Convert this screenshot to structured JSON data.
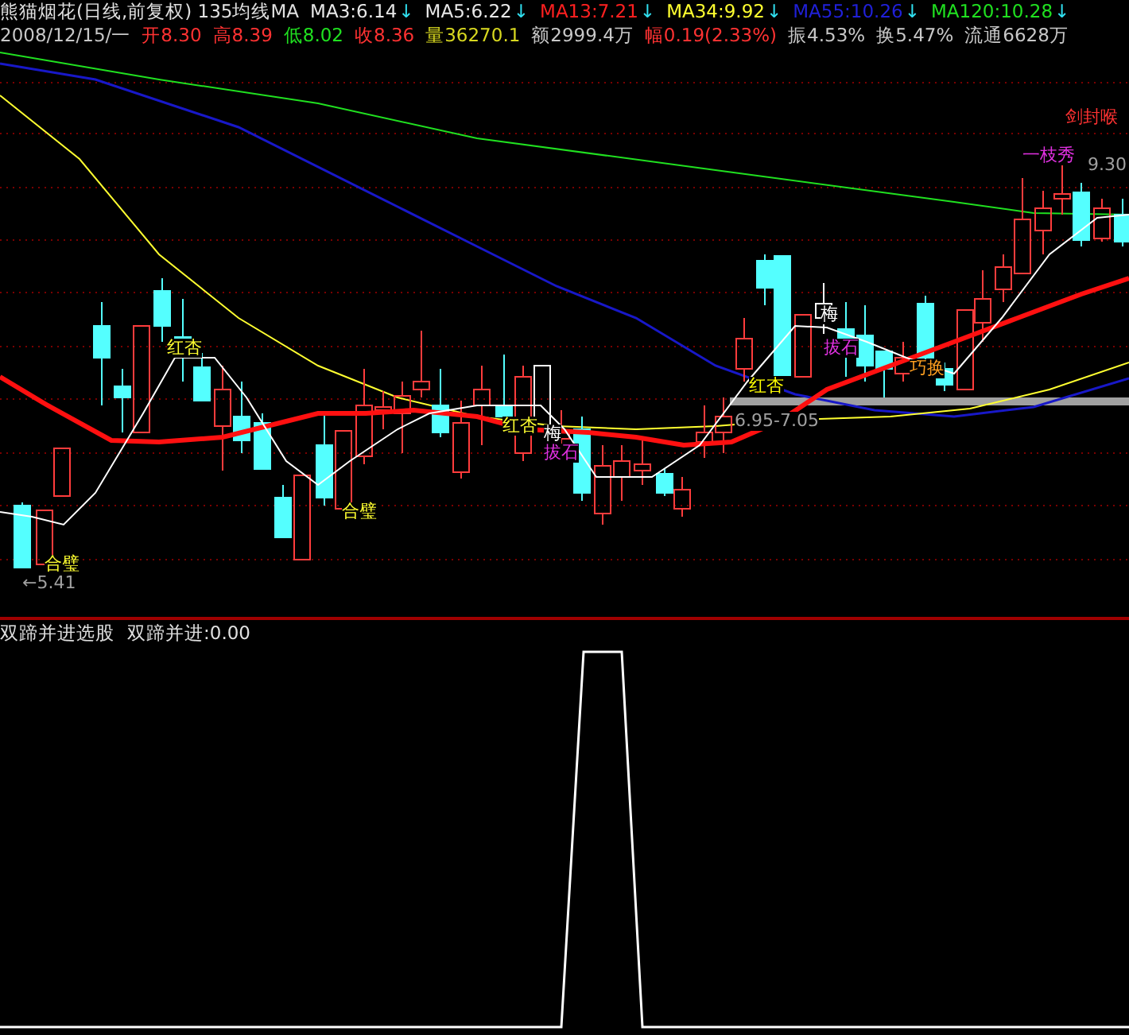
{
  "chart_title": {
    "name": "熊猫烟花(日线,前复权)",
    "indicator": "135均线MA"
  },
  "moving_averages": [
    {
      "label": "MA3:6.14",
      "arrow": "↓",
      "color": "#e8e8e8"
    },
    {
      "label": "MA5:6.22",
      "arrow": "↓",
      "color": "#e8e8e8"
    },
    {
      "label": "MA13:7.21",
      "arrow": "↓",
      "color": "#ff2020"
    },
    {
      "label": "MA34:9.92",
      "arrow": "↓",
      "color": "#ffff30"
    },
    {
      "label": "MA55:10.26",
      "arrow": "↓",
      "color": "#2020d8"
    },
    {
      "label": "MA120:10.28",
      "arrow": "↓",
      "color": "#20e020"
    }
  ],
  "quote": [
    {
      "label": "2008/12/15/一",
      "color": "#c8c8c8"
    },
    {
      "label": "开8.30",
      "color": "#ff3232"
    },
    {
      "label": "高8.39",
      "color": "#ff3232"
    },
    {
      "label": "低8.02",
      "color": "#20e020"
    },
    {
      "label": "收8.36",
      "color": "#ff3232"
    },
    {
      "label": "量36270.1",
      "color": "#d8d820"
    },
    {
      "label": "额2999.4万",
      "color": "#c8c8c8"
    },
    {
      "label": "幅0.19(2.33%)",
      "color": "#ff3232"
    },
    {
      "label": "振4.53%",
      "color": "#c8c8c8"
    },
    {
      "label": "换5.47%",
      "color": "#c8c8c8"
    },
    {
      "label": "流通6628万",
      "color": "#c8c8c8"
    }
  ],
  "signals": [
    {
      "text": "红杏",
      "color": "#ffff30"
    },
    {
      "text": "合璧",
      "color": "#ffff30"
    },
    {
      "text": "合璧",
      "color": "#ffff30"
    },
    {
      "text": "←5.41",
      "color": "#a0a0a0"
    },
    {
      "text": "红杏",
      "color": "#ffff30"
    },
    {
      "text": "梅",
      "color": "#ffffff"
    },
    {
      "text": "拔石",
      "color": "#e030e0"
    },
    {
      "text": "红杏",
      "color": "#ffff00"
    },
    {
      "text": "6.95-7.05",
      "color": "#a0a0a0"
    },
    {
      "text": "梅",
      "color": "#ffffff"
    },
    {
      "text": "拔石",
      "color": "#e030e0"
    },
    {
      "text": "巧换",
      "color": "#ffa020"
    },
    {
      "text": "剑封喉",
      "color": "#ff3232"
    },
    {
      "text": "一枝秀",
      "color": "#e030e0"
    },
    {
      "text": "9.30",
      "color": "#a0a0a0"
    }
  ],
  "indicator_panel": {
    "title": "双蹄并进选股",
    "reading": "双蹄并进:0.00"
  }
}
